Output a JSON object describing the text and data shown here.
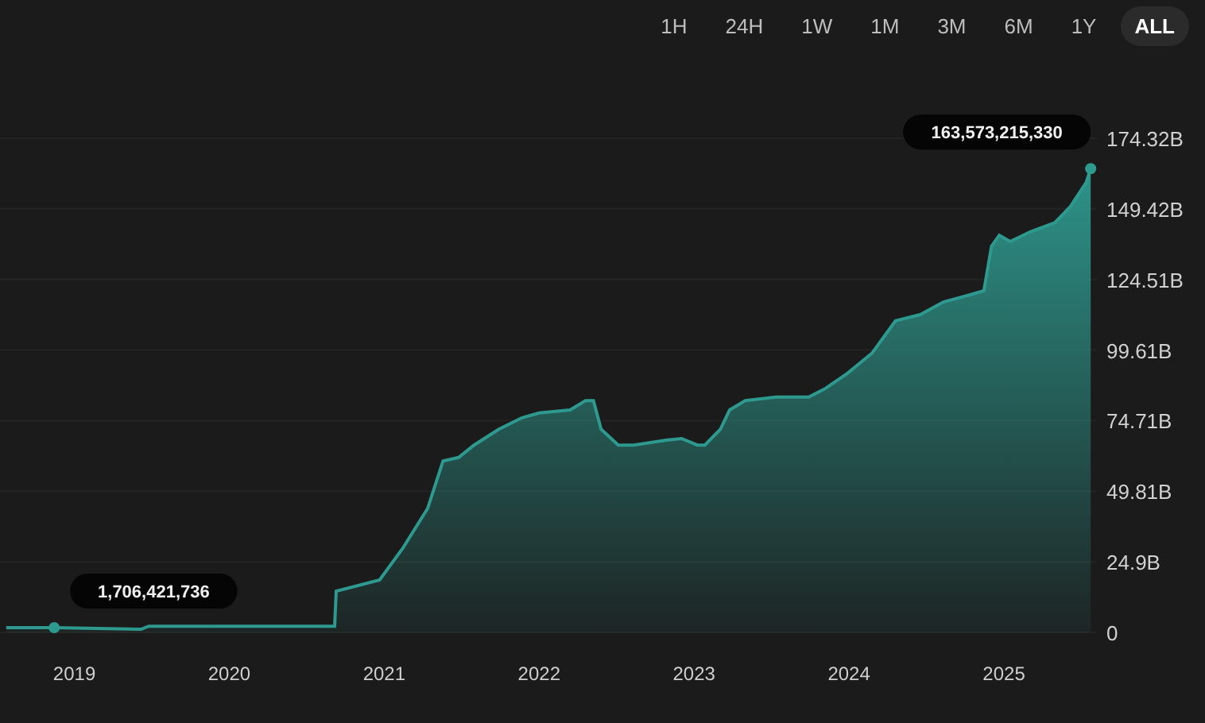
{
  "range_buttons": [
    {
      "label": "1H",
      "selected": false
    },
    {
      "label": "24H",
      "selected": false
    },
    {
      "label": "1W",
      "selected": false
    },
    {
      "label": "1M",
      "selected": false
    },
    {
      "label": "3M",
      "selected": false
    },
    {
      "label": "6M",
      "selected": false
    },
    {
      "label": "1Y",
      "selected": false
    },
    {
      "label": "ALL",
      "selected": true
    }
  ],
  "chart": {
    "chart_data": {
      "type": "area",
      "x": [
        2018.56,
        2018.87,
        2019.43,
        2019.48,
        2020.68,
        2020.69,
        2020.97,
        2021.12,
        2021.28,
        2021.38,
        2021.48,
        2021.58,
        2021.74,
        2021.89,
        2022.0,
        2022.2,
        2022.3,
        2022.35,
        2022.4,
        2022.51,
        2022.61,
        2022.82,
        2022.92,
        2023.02,
        2023.07,
        2023.17,
        2023.23,
        2023.33,
        2023.53,
        2023.74,
        2023.84,
        2023.99,
        2024.15,
        2024.3,
        2024.46,
        2024.61,
        2024.76,
        2024.87,
        2024.92,
        2024.97,
        2025.04,
        2025.17,
        2025.33,
        2025.43,
        2025.53,
        2025.56
      ],
      "grid": true,
      "series": [
        {
          "color": "#2e9a8f",
          "values": [
            1.7,
            1.7,
            1.1,
            2.2,
            2.2,
            14.6,
            18.5,
            29.7,
            43.7,
            60.5,
            61.7,
            66.1,
            71.7,
            75.7,
            77.4,
            78.5,
            81.8,
            81.8,
            71.7,
            66.1,
            66.1,
            67.8,
            68.4,
            66.1,
            66.1,
            71.7,
            78.5,
            81.8,
            83.0,
            83.0,
            85.8,
            91.4,
            98.6,
            109.9,
            112.1,
            116.6,
            118.8,
            120.5,
            136.2,
            140.1,
            137.9,
            141.3,
            144.6,
            150.3,
            158.7,
            163.6
          ]
        }
      ],
      "xlim": [
        2018.52,
        2025.6
      ],
      "ylim": [
        0,
        174.32
      ],
      "xticks": [
        {
          "value": 2019,
          "label": "2019"
        },
        {
          "value": 2020,
          "label": "2020"
        },
        {
          "value": 2021,
          "label": "2021"
        },
        {
          "value": 2022,
          "label": "2022"
        },
        {
          "value": 2023,
          "label": "2023"
        },
        {
          "value": 2024,
          "label": "2024"
        },
        {
          "value": 2025,
          "label": "2025"
        }
      ],
      "yticks": [
        {
          "value": 0,
          "label": "0"
        },
        {
          "value": 24.9,
          "label": "24.9B"
        },
        {
          "value": 49.81,
          "label": "49.81B"
        },
        {
          "value": 74.71,
          "label": "74.71B"
        },
        {
          "value": 99.61,
          "label": "99.61B"
        },
        {
          "value": 124.51,
          "label": "124.51B"
        },
        {
          "value": 149.42,
          "label": "149.42B"
        },
        {
          "value": 174.32,
          "label": "174.32B"
        }
      ],
      "annotations": [
        {
          "x": 2018.87,
          "y": 1.7,
          "text": "1,706,421,736"
        },
        {
          "x": 2025.56,
          "y": 163.6,
          "text": "163,573,215,330"
        }
      ]
    }
  }
}
